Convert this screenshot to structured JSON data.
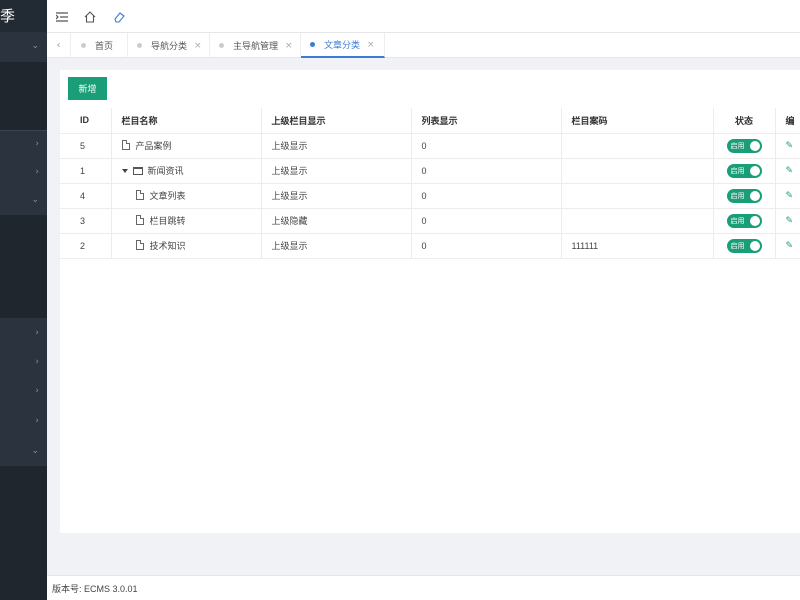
{
  "sidebar": {
    "logo_glyph": "季",
    "chevrons": [
      "⌄",
      "›",
      "›",
      "⌄",
      "›",
      "›",
      "›",
      "›",
      "⌄"
    ]
  },
  "topbar": {
    "icons": [
      "menu-fold-icon",
      "home-icon",
      "eraser-icon"
    ]
  },
  "tabs": [
    {
      "label": "首页",
      "active": false,
      "closable": false
    },
    {
      "label": "导航分类",
      "active": false,
      "closable": true
    },
    {
      "label": "主导航管理",
      "active": false,
      "closable": true
    },
    {
      "label": "文章分类",
      "active": true,
      "closable": true
    }
  ],
  "tabs_prev_glyph": "‹",
  "tab_close_glyph": "×",
  "content": {
    "add_button": "新增",
    "table": {
      "headers": [
        "ID",
        "栏目名称",
        "上级栏目显示",
        "列表显示",
        "栏目案码",
        "状态",
        "编"
      ],
      "rows": [
        {
          "id": "5",
          "name": "产品案例",
          "icon": "file-icon",
          "indent": false,
          "parent_display": "上级显示",
          "list_display": "0",
          "code": "",
          "status": "启用"
        },
        {
          "id": "1",
          "name": "新闻资讯",
          "icon": "folder-icon",
          "indent": false,
          "expanded": true,
          "parent_display": "上级显示",
          "list_display": "0",
          "code": "",
          "status": "启用"
        },
        {
          "id": "4",
          "name": "文章列表",
          "icon": "file-icon",
          "indent": true,
          "parent_display": "上级显示",
          "list_display": "0",
          "code": "",
          "status": "启用"
        },
        {
          "id": "3",
          "name": "栏目跳转",
          "icon": "file-icon",
          "indent": true,
          "parent_display": "上级隐藏",
          "list_display": "0",
          "code": "",
          "status": "启用"
        },
        {
          "id": "2",
          "name": "技术知识",
          "icon": "file-icon",
          "indent": true,
          "parent_display": "上级显示",
          "list_display": "0",
          "code": "111111",
          "status": "启用"
        }
      ],
      "edit_glyph": "✎"
    }
  },
  "footer": {
    "version": "版本号: ECMS 3.0.01"
  },
  "colors": {
    "sidebar_bg": "#2b333e",
    "accent_green": "#1a9e77",
    "active_tab": "#3a7bd5"
  }
}
